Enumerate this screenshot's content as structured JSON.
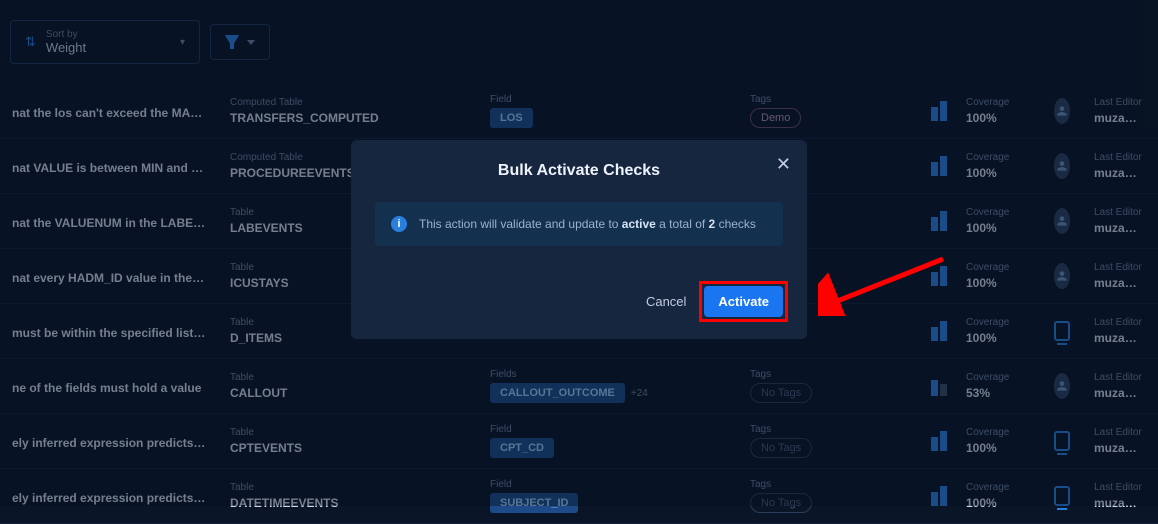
{
  "toolbar": {
    "sort_label": "Sort by",
    "sort_value": "Weight"
  },
  "modal": {
    "title": "Bulk Activate Checks",
    "info_prefix": "This action will validate and update to",
    "info_strong1": "active",
    "info_mid": "a total of",
    "info_count": "2",
    "info_suffix": "checks",
    "cancel": "Cancel",
    "activate": "Activate"
  },
  "labels": {
    "computed_table": "Computed Table",
    "table": "Table",
    "field": "Field",
    "fields": "Fields",
    "tags": "Tags",
    "coverage": "Coverage",
    "last_editor": "Last Editor",
    "no_tags": "No Tags"
  },
  "rows": [
    {
      "desc": "nat the los can't exceed the MAX valu...",
      "table_label": "Computed Table",
      "table": "TRANSFERS_COMPUTED",
      "field_label": "Field",
      "field": "LOS",
      "field_extra": "",
      "tag": "Demo",
      "coverage": "100%",
      "editor": "muzammilhasa...",
      "avatar": "user"
    },
    {
      "desc": "nat VALUE is between MIN and MAX",
      "table_label": "Computed Table",
      "table": "PROCEDUREEVENTS_M...",
      "field_label": "Field",
      "field": "",
      "field_extra": "",
      "tag": "",
      "coverage": "100%",
      "editor": "muzammilhasa...",
      "avatar": "user"
    },
    {
      "desc": "nat the VALUENUM in the LABEVENTS...",
      "table_label": "Table",
      "table": "LABEVENTS",
      "field_label": "",
      "field": "",
      "field_extra": "",
      "tag": "",
      "coverage": "100%",
      "editor": "muzammilhasa...",
      "avatar": "user"
    },
    {
      "desc": "nat every HADM_ID value in the ICUS...",
      "table_label": "Table",
      "table": "ICUSTAYS",
      "field_label": "",
      "field": "",
      "field_extra": "",
      "tag": "",
      "coverage": "100%",
      "editor": "muzammilhasa...",
      "avatar": "user"
    },
    {
      "desc": "must be within the specified list of v...",
      "table_label": "Table",
      "table": "D_ITEMS",
      "field_label": "",
      "field": "",
      "field_extra": "",
      "tag": "",
      "coverage": "100%",
      "editor": "muzammilhasa...",
      "avatar": "monitor"
    },
    {
      "desc": "ne of the fields must hold a value",
      "table_label": "Table",
      "table": "CALLOUT",
      "field_label": "Fields",
      "field": "CALLOUT_OUTCOME",
      "field_extra": "+24",
      "tag": "none",
      "coverage": "53%",
      "editor": "muzammilhasa...",
      "avatar": "user",
      "partial": true
    },
    {
      "desc": "ely inferred expression predicts a val...",
      "table_label": "Table",
      "table": "CPTEVENTS",
      "field_label": "Field",
      "field": "CPT_CD",
      "field_extra": "",
      "tag": "none",
      "coverage": "100%",
      "editor": "muzammilhasa...",
      "avatar": "monitor"
    },
    {
      "desc": "ely inferred expression predicts a val...",
      "table_label": "Table",
      "table": "DATETIMEEVENTS",
      "field_label": "Field",
      "field": "SUBJECT_ID",
      "field_extra": "",
      "tag": "none",
      "coverage": "100%",
      "editor": "muzammilhasa...",
      "avatar": "monitor"
    }
  ]
}
